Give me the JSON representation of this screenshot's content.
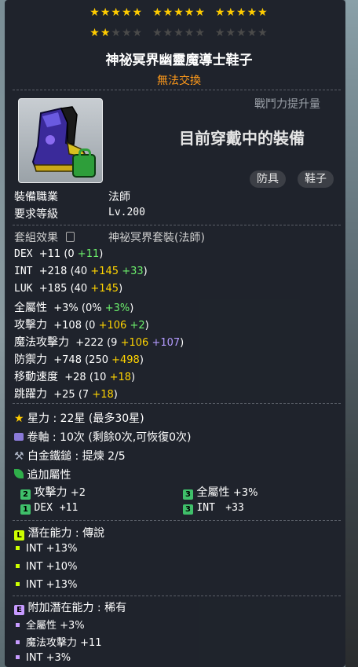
{
  "stars": {
    "filled": 17,
    "total": 30
  },
  "item": {
    "name": "神祕冥界幽靈魔導士鞋子",
    "trade_status": "無法交換",
    "power_label": "戰鬥力提升量",
    "equipped_text": "目前穿戴中的裝備",
    "tags": [
      "防具",
      "鞋子"
    ]
  },
  "requirements": {
    "job_label": "裝備職業",
    "job_value": "法師",
    "level_label": "要求等級",
    "level_value": "Lv.200"
  },
  "set_effect": {
    "label": "套組效果",
    "value": "神祕冥界套裝(法師)"
  },
  "stats": [
    {
      "name": "DEX",
      "total": "+11",
      "open": "(0 ",
      "parts": [
        {
          "text": "+11",
          "color": "green"
        }
      ]
    },
    {
      "name": "INT",
      "total": "+218",
      "open": "(40 ",
      "parts": [
        {
          "text": "+145",
          "color": "yellow"
        },
        {
          "text": " "
        },
        {
          "text": "+33",
          "color": "green"
        }
      ]
    },
    {
      "name": "LUK",
      "total": "+185",
      "open": "(40 ",
      "parts": [
        {
          "text": "+145",
          "color": "yellow"
        }
      ]
    },
    {
      "name": "全屬性",
      "total": "+3%",
      "open": "(0% ",
      "parts": [
        {
          "text": "+3%",
          "color": "green"
        }
      ]
    },
    {
      "name": "攻擊力",
      "total": "+108",
      "open": "(0 ",
      "parts": [
        {
          "text": "+106",
          "color": "yellow"
        },
        {
          "text": " "
        },
        {
          "text": "+2",
          "color": "green"
        }
      ]
    },
    {
      "name": "魔法攻擊力",
      "total": "+222",
      "open": "(9 ",
      "parts": [
        {
          "text": "+106",
          "color": "yellow"
        },
        {
          "text": " "
        },
        {
          "text": "+107",
          "color": "purple"
        }
      ]
    },
    {
      "name": "防禦力",
      "total": "+748",
      "open": "(250 ",
      "parts": [
        {
          "text": "+498",
          "color": "yellow"
        }
      ]
    },
    {
      "name": "移動速度",
      "total": "+28",
      "open": "(10 ",
      "parts": [
        {
          "text": "+18",
          "color": "yellow"
        }
      ]
    },
    {
      "name": "跳躍力",
      "total": "+25",
      "open": "(7 ",
      "parts": [
        {
          "text": "+18",
          "color": "yellow"
        }
      ]
    }
  ],
  "enhance": {
    "starforce": "星力 : 22星 (最多30星)",
    "scroll": "卷軸 : 10次 (剩餘0次,可恢復0次)",
    "hammer": "白金鐵鎚 : 提煉 2/5",
    "bonus_label": "追加屬性",
    "bonus": [
      {
        "grade": "2",
        "stat": "攻擊力",
        "value": "+2"
      },
      {
        "grade": "3",
        "stat": "全屬性",
        "value": "+3%"
      },
      {
        "grade": "1",
        "stat": "DEX",
        "value": "+11"
      },
      {
        "grade": "3",
        "stat": "INT",
        "value": "+33"
      }
    ]
  },
  "potential": {
    "badge": "L",
    "label": "潛在能力",
    "sep": ":",
    "grade": "傳說",
    "lines": [
      "INT +13%",
      "INT +10%",
      "INT +13%"
    ],
    "color": "#ccff00"
  },
  "additional": {
    "badge": "E",
    "label": "附加潛在能力",
    "sep": ":",
    "grade": "稀有",
    "lines": [
      "全屬性 +3%",
      "魔法攻擊力 +11",
      "INT +3%"
    ],
    "color": "#c79bff"
  }
}
